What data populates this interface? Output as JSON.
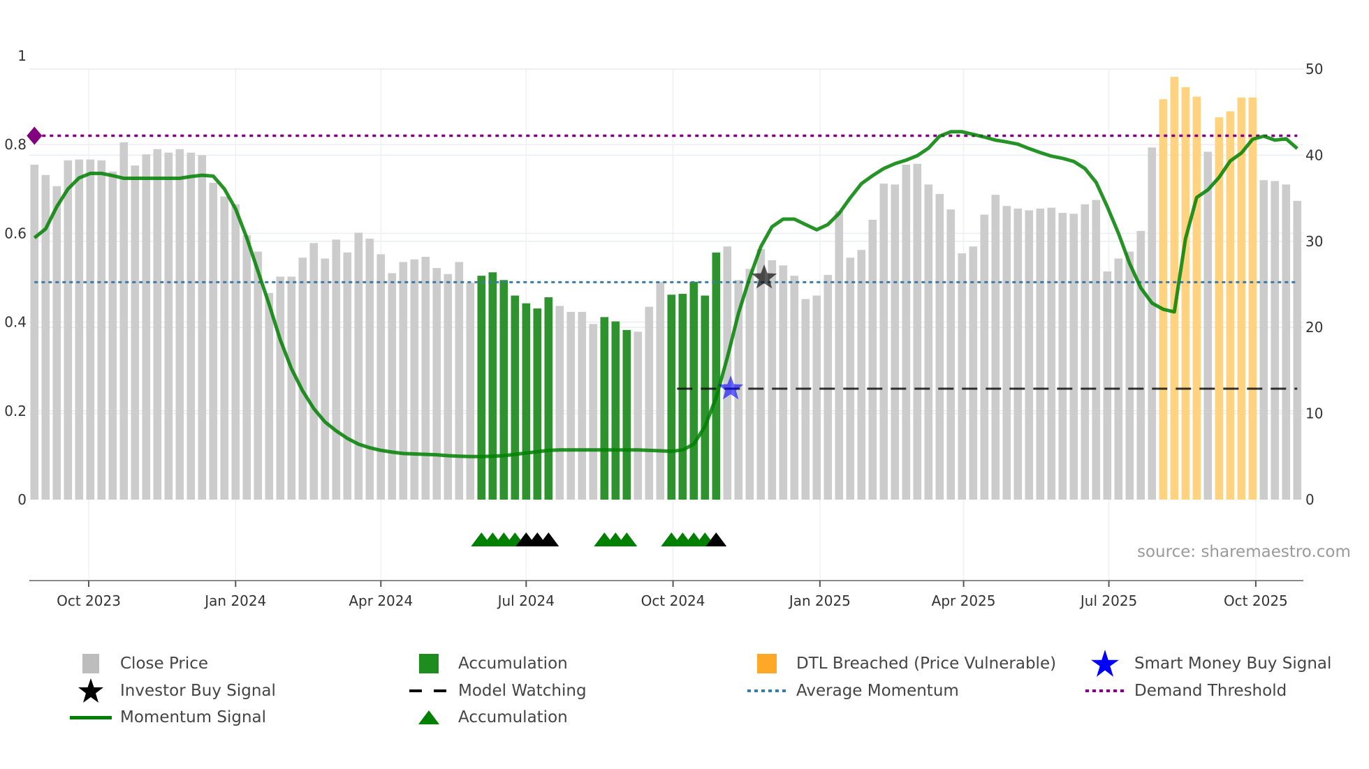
{
  "chart_data": {
    "type": "bar",
    "title": "",
    "start_date": "2023-08-28",
    "interval_days": 7,
    "close_price": [
      38.9,
      37.7,
      36.4,
      39.4,
      39.5,
      39.5,
      39.4,
      38.1,
      41.5,
      38.8,
      40.1,
      40.7,
      40.3,
      40.7,
      40.3,
      40.0,
      36.8,
      35.2,
      34.3,
      30.7,
      28.8,
      24.0,
      25.9,
      25.9,
      28.1,
      29.8,
      28.0,
      30.2,
      28.7,
      31.0,
      30.3,
      28.5,
      26.3,
      27.6,
      27.9,
      28.2,
      26.9,
      26.2,
      27.6,
      25.2,
      26.0,
      26.4,
      25.5,
      23.7,
      22.8,
      22.2,
      23.5,
      22.5,
      21.8,
      21.8,
      20.4,
      21.2,
      20.7,
      19.7,
      19.5,
      22.4,
      25.3,
      23.8,
      23.9,
      25.3,
      23.7,
      28.7,
      29.4,
      25.5,
      26.8,
      29.1,
      27.8,
      27.2,
      26.0,
      23.3,
      23.7,
      26.1,
      33.5,
      28.1,
      29.0,
      32.5,
      36.7,
      36.6,
      38.9,
      39.0,
      36.6,
      35.5,
      33.7,
      28.6,
      29.4,
      33.1,
      35.4,
      34.1,
      33.8,
      33.6,
      33.8,
      33.9,
      33.3,
      33.2,
      34.3,
      34.8,
      26.5,
      28.0,
      28.8,
      31.2,
      40.9,
      46.5,
      49.1,
      47.9,
      46.8,
      40.4,
      44.4,
      45.1,
      46.7,
      46.7,
      37.1,
      37.0,
      36.6,
      34.7
    ],
    "momentum": [
      0.59,
      0.61,
      0.66,
      0.7,
      0.725,
      0.735,
      0.735,
      0.73,
      0.724,
      0.724,
      0.724,
      0.724,
      0.724,
      0.724,
      0.728,
      0.731,
      0.729,
      0.7,
      0.655,
      0.59,
      0.515,
      0.44,
      0.36,
      0.295,
      0.245,
      0.205,
      0.175,
      0.155,
      0.138,
      0.125,
      0.117,
      0.111,
      0.107,
      0.104,
      0.103,
      0.102,
      0.101,
      0.099,
      0.098,
      0.097,
      0.097,
      0.098,
      0.099,
      0.102,
      0.105,
      0.108,
      0.111,
      0.112,
      0.112,
      0.112,
      0.112,
      0.112,
      0.112,
      0.112,
      0.112,
      0.111,
      0.11,
      0.109,
      0.112,
      0.125,
      0.165,
      0.23,
      0.32,
      0.42,
      0.5,
      0.57,
      0.615,
      0.632,
      0.632,
      0.62,
      0.608,
      0.62,
      0.645,
      0.68,
      0.712,
      0.73,
      0.746,
      0.757,
      0.765,
      0.775,
      0.792,
      0.819,
      0.829,
      0.829,
      0.823,
      0.817,
      0.81,
      0.806,
      0.801,
      0.791,
      0.782,
      0.774,
      0.769,
      0.762,
      0.746,
      0.715,
      0.66,
      0.6,
      0.532,
      0.477,
      0.443,
      0.429,
      0.423,
      0.588,
      0.681,
      0.698,
      0.726,
      0.763,
      0.781,
      0.812,
      0.819,
      0.81,
      0.813,
      0.791
    ],
    "accumulation_bar_indices": [
      40,
      41,
      42,
      43,
      44,
      45,
      46,
      51,
      52,
      53,
      57,
      58,
      59,
      60,
      61
    ],
    "dtl_breached_bar_indices": [
      101,
      102,
      103,
      104,
      106,
      107,
      108,
      109
    ],
    "demand_threshold": 0.82,
    "average_momentum": 0.49,
    "model_watching": {
      "value": 0.25,
      "start_index": 57.5
    },
    "investor_buy_signals": [
      {
        "index": 65.3,
        "value": 0.5
      }
    ],
    "smart_money_buy_signals": [
      {
        "index": 62.3,
        "value": 0.25
      }
    ],
    "accumulation_triangles": {
      "green": [
        40,
        41,
        42,
        43,
        51,
        52,
        53,
        57,
        58,
        59,
        60
      ],
      "black": [
        44,
        45,
        46,
        61
      ]
    },
    "x_ticks": [
      {
        "label": "Oct 2023",
        "date": "2023-10-01"
      },
      {
        "label": "Jan 2024",
        "date": "2024-01-01"
      },
      {
        "label": "Apr 2024",
        "date": "2024-04-01"
      },
      {
        "label": "Jul 2024",
        "date": "2024-07-01"
      },
      {
        "label": "Oct 2024",
        "date": "2024-10-01"
      },
      {
        "label": "Jan 2025",
        "date": "2025-01-01"
      },
      {
        "label": "Apr 2025",
        "date": "2025-04-01"
      },
      {
        "label": "Jul 2025",
        "date": "2025-07-01"
      },
      {
        "label": "Oct 2025",
        "date": "2025-10-01"
      }
    ],
    "y_left": {
      "range": [
        0,
        1
      ],
      "ticks": [
        0,
        0.2,
        0.4,
        0.6,
        0.8,
        1
      ],
      "tick_labels": [
        "0",
        "0.2",
        "0.4",
        "0.6",
        "0.8",
        "1"
      ]
    },
    "y_right": {
      "range": [
        0,
        50
      ],
      "ticks": [
        0,
        10,
        20,
        30,
        40,
        50
      ],
      "tick_labels": [
        "0",
        "10",
        "20",
        "30",
        "40",
        "50"
      ]
    },
    "grid": true,
    "legend_placement": "bottom",
    "colors": {
      "close": "#cccccc",
      "accumulation": "#2e932e",
      "dtl": "#ffd381",
      "dtl_legend": "#ffa726",
      "momentum": "#008000",
      "average": "#3a7ca5",
      "demand": "#800080",
      "smart_star": "#0000ff",
      "investor_star": "#000000",
      "triangle_green": "#008000",
      "triangle_black": "#000000"
    }
  },
  "legend": {
    "close_price": "Close Price",
    "accumulation_bar": "Accumulation",
    "dtl_breached": "DTL Breached (Price Vulnerable)",
    "smart_money": "Smart Money Buy Signal",
    "investor_buy": "Investor Buy Signal",
    "model_watching": "Model Watching",
    "average_momentum": "Average Momentum",
    "demand_threshold": "Demand Threshold",
    "momentum_signal": "Momentum Signal",
    "accumulation_triangle": "Accumulation"
  },
  "source": "source: sharemaestro.com"
}
